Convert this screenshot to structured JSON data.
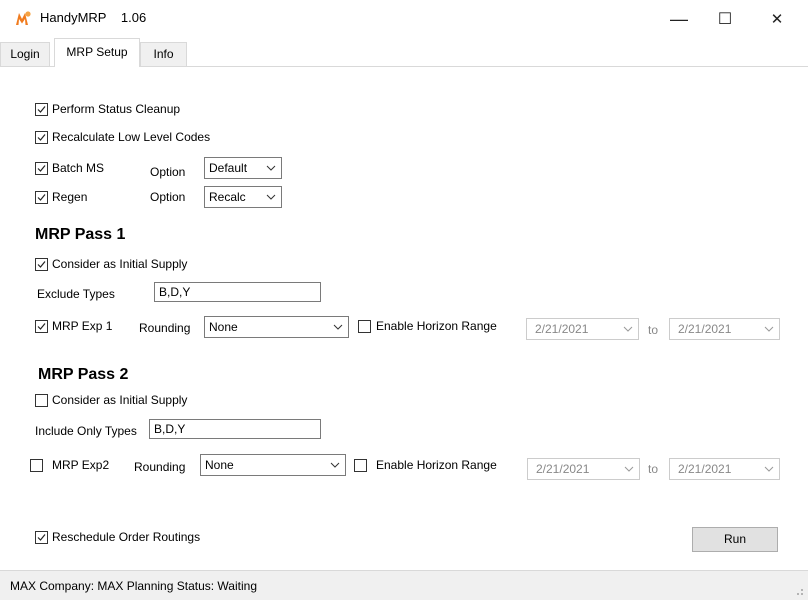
{
  "window": {
    "title": "HandyMRP",
    "version": "1.06",
    "minimize": "—",
    "maximize": "☐",
    "close": "✕"
  },
  "tabs": [
    {
      "label": "Login"
    },
    {
      "label": "MRP Setup"
    },
    {
      "label": "Info"
    }
  ],
  "options": {
    "perform_status_cleanup": {
      "label": "Perform Status Cleanup",
      "checked": true
    },
    "recalc_llc": {
      "label": "Recalculate Low Level Codes",
      "checked": true
    },
    "batch_ms": {
      "label": "Batch MS",
      "checked": true,
      "option_label": "Option",
      "option_value": "Default"
    },
    "regen": {
      "label": "Regen",
      "checked": true,
      "option_label": "Option",
      "option_value": "Recalc"
    }
  },
  "pass1": {
    "header": "MRP Pass 1",
    "initial_supply": {
      "label": "Consider as Initial Supply",
      "checked": true
    },
    "types_label": "Exclude Types",
    "types_value": "B,D,Y",
    "exp": {
      "label": "MRP Exp 1",
      "checked": true
    },
    "rounding_label": "Rounding",
    "rounding_value": "None",
    "horizon": {
      "label": "Enable Horizon Range",
      "checked": false
    },
    "from_date": "2/21/2021",
    "to_label": "to",
    "to_date": "2/21/2021"
  },
  "pass2": {
    "header": "MRP Pass 2",
    "initial_supply": {
      "label": "Consider as Initial Supply",
      "checked": false
    },
    "types_label": "Include Only Types",
    "types_value": "B,D,Y",
    "exp": {
      "label": "MRP Exp2",
      "checked": false
    },
    "rounding_label": "Rounding",
    "rounding_value": "None",
    "horizon": {
      "label": "Enable Horizon Range",
      "checked": false
    },
    "from_date": "2/21/2021",
    "to_label": "to",
    "to_date": "2/21/2021"
  },
  "reschedule": {
    "label": "Reschedule Order Routings",
    "checked": true
  },
  "run_label": "Run",
  "status": "MAX Company: MAX Planning  Status: Waiting",
  "colors": {
    "app_icon": "#f07b1e",
    "tab_bg": "#f0f0f0",
    "status_bg": "#f0f0f0"
  }
}
